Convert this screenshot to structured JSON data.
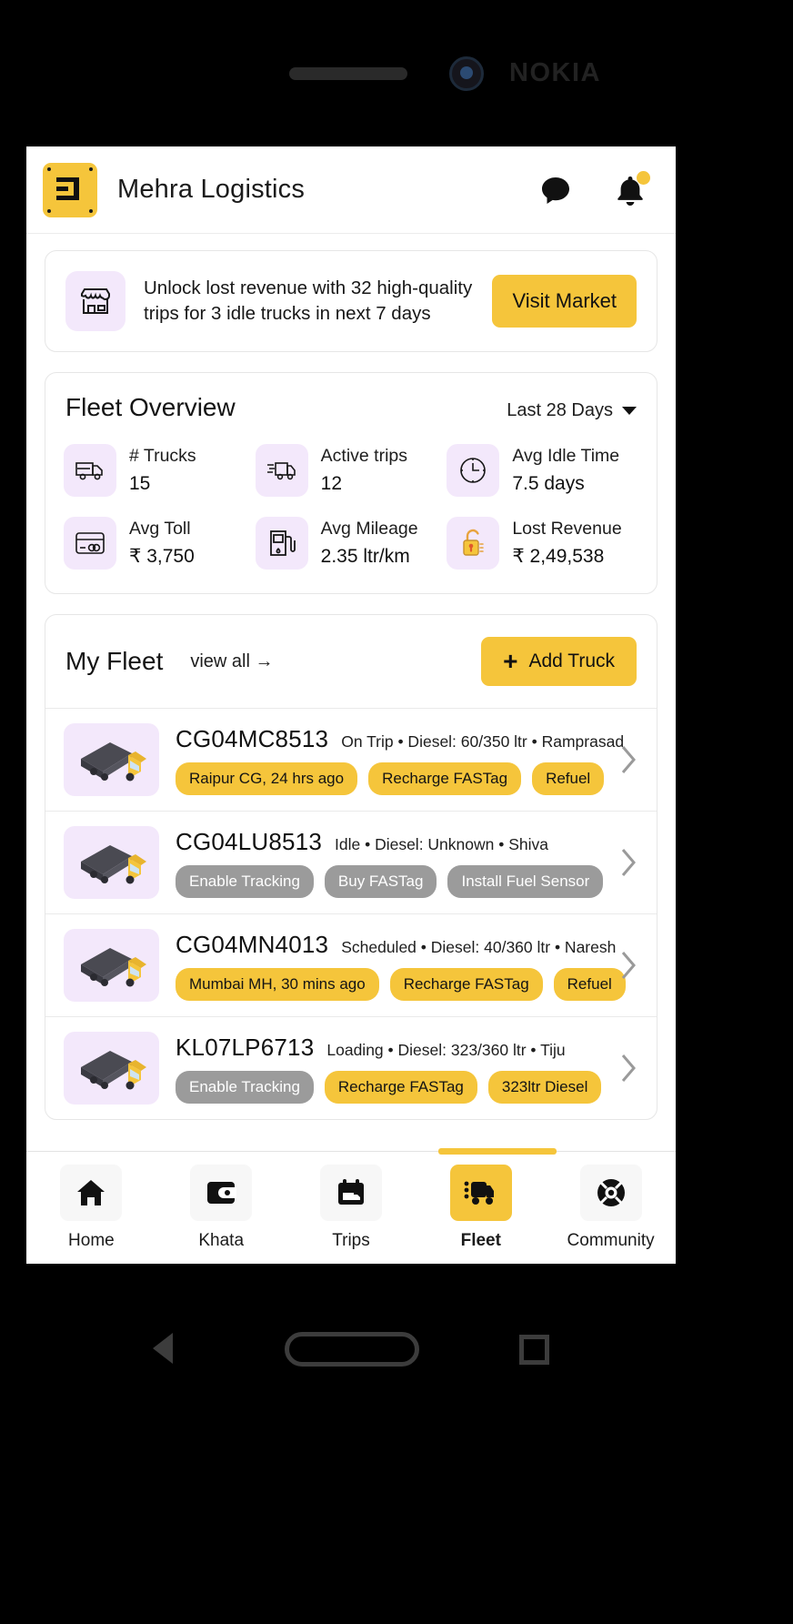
{
  "device": {
    "brand": "NOKIA"
  },
  "header": {
    "company": "Mehra Logistics",
    "logo_text": "ЭТ",
    "chat_icon": "chat-bubble-icon",
    "notification_icon": "bell-icon"
  },
  "promo": {
    "icon": "storefront-icon",
    "text": "Unlock lost revenue with 32 high-quality trips for 3 idle trucks in next 7 days",
    "cta": "Visit Market"
  },
  "overview": {
    "title": "Fleet Overview",
    "range": "Last 28 Days",
    "stats": [
      {
        "icon": "truck-side-icon",
        "label": "# Trucks",
        "value": "15"
      },
      {
        "icon": "fast-truck-icon",
        "label": "Active trips",
        "value": "12"
      },
      {
        "icon": "clock-icon",
        "label": "Avg Idle Time",
        "value": "7.5 days"
      },
      {
        "icon": "toll-card-icon",
        "label": "Avg Toll",
        "value": "₹ 3,750"
      },
      {
        "icon": "fuel-pump-icon",
        "label": "Avg Mileage",
        "value": "2.35 ltr/km"
      },
      {
        "icon": "open-lock-icon",
        "label": "Lost Revenue",
        "value": "₹ 2,49,538"
      }
    ]
  },
  "fleet": {
    "title": "My Fleet",
    "view_all": "view all  →",
    "add_truck": "Add Truck",
    "trucks": [
      {
        "plate": "CG04MC8513",
        "status": "On Trip",
        "diesel": "Diesel: 60/350 ltr",
        "driver": "Ramprasad",
        "meta": "On Trip  •  Diesel: 60/350 ltr  •  Ramprasad",
        "chips": [
          {
            "label": "Raipur CG, 24 hrs ago",
            "style": "yellow"
          },
          {
            "label": "Recharge FASTag",
            "style": "yellow"
          },
          {
            "label": "Refuel",
            "style": "yellow"
          }
        ]
      },
      {
        "plate": "CG04LU8513",
        "status": "Idle",
        "diesel": "Diesel: Unknown",
        "driver": "Shiva",
        "meta": "Idle  •  Diesel: Unknown  •  Shiva",
        "chips": [
          {
            "label": "Enable Tracking",
            "style": "grey"
          },
          {
            "label": "Buy FASTag",
            "style": "grey"
          },
          {
            "label": "Install Fuel Sensor",
            "style": "grey"
          }
        ]
      },
      {
        "plate": "CG04MN4013",
        "status": "Scheduled",
        "diesel": "Diesel: 40/360 ltr",
        "driver": "Naresh",
        "meta": "Scheduled  •  Diesel: 40/360 ltr  •  Naresh",
        "chips": [
          {
            "label": "Mumbai MH, 30 mins ago",
            "style": "yellow"
          },
          {
            "label": "Recharge FASTag",
            "style": "yellow"
          },
          {
            "label": "Refuel",
            "style": "yellow"
          }
        ]
      },
      {
        "plate": "KL07LP6713",
        "status": "Loading",
        "diesel": "Diesel: 323/360 ltr",
        "driver": "Tiju",
        "meta": "Loading  •  Diesel: 323/360 ltr  •  Tiju",
        "chips": [
          {
            "label": "Enable Tracking",
            "style": "grey"
          },
          {
            "label": "Recharge FASTag",
            "style": "yellow"
          },
          {
            "label": "323ltr Diesel",
            "style": "yellow"
          }
        ]
      }
    ]
  },
  "tabbar": {
    "active_index": 3,
    "tabs": [
      {
        "label": "Home",
        "icon": "home-icon"
      },
      {
        "label": "Khata",
        "icon": "wallet-icon"
      },
      {
        "label": "Trips",
        "icon": "calendar-truck-icon"
      },
      {
        "label": "Fleet",
        "icon": "truck-icon"
      },
      {
        "label": "Community",
        "icon": "lifebuoy-icon"
      }
    ]
  },
  "colors": {
    "accent": "#F5C53B",
    "icon_tile": "#F3E8FB",
    "chip_grey": "#9b9b9b"
  }
}
